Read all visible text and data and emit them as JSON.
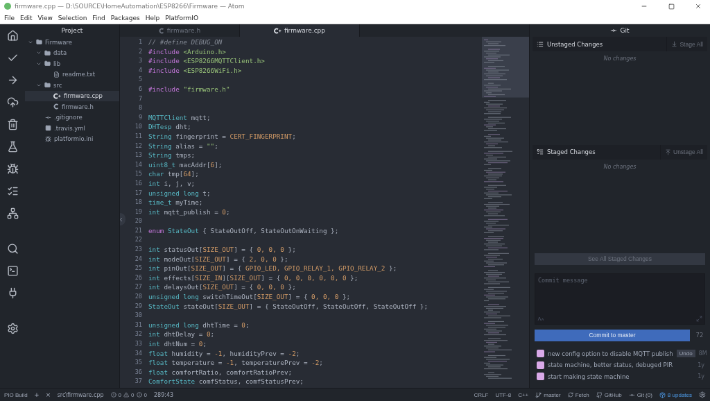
{
  "window": {
    "title": "firmware.cpp — D:\\SOURCE\\HomeAutomation\\ESP8266\\Firmware — Atom"
  },
  "menu": [
    "File",
    "Edit",
    "View",
    "Selection",
    "Find",
    "Packages",
    "Help",
    "PlatformIO"
  ],
  "project": {
    "title": "Project",
    "tree": [
      {
        "label": "Firmware",
        "kind": "folder",
        "expanded": true,
        "selected": false,
        "children": [
          {
            "label": "data",
            "kind": "folder",
            "expanded": true,
            "selected": false
          },
          {
            "label": "lib",
            "kind": "folder",
            "expanded": true,
            "selected": false,
            "children": [
              {
                "label": "readme.txt",
                "kind": "text",
                "selected": false
              }
            ]
          },
          {
            "label": "src",
            "kind": "folder",
            "expanded": true,
            "selected": false,
            "children": [
              {
                "label": "firmware.cpp",
                "kind": "cpp",
                "selected": true
              },
              {
                "label": "firmware.h",
                "kind": "c",
                "selected": false
              }
            ]
          },
          {
            "label": ".gitignore",
            "kind": "git",
            "selected": false
          },
          {
            "label": ".travis.yml",
            "kind": "yml",
            "selected": false
          },
          {
            "label": "platformio.ini",
            "kind": "pio",
            "selected": false
          }
        ]
      }
    ]
  },
  "tabs": [
    {
      "label": "firmware.h",
      "kind": "c",
      "selected": false
    },
    {
      "label": "firmware.cpp",
      "kind": "cpp",
      "selected": true
    }
  ],
  "code": [
    {
      "num": "1",
      "tokens": [
        {
          "kind": "comment",
          "text": "// #define DEBUG_ON"
        }
      ]
    },
    {
      "num": "2",
      "tokens": [
        {
          "kind": "directive",
          "text": "#include"
        },
        {
          "kind": "string",
          "text": " <Arduino.h>"
        }
      ]
    },
    {
      "num": "3",
      "tokens": [
        {
          "kind": "directive",
          "text": "#include"
        },
        {
          "kind": "string",
          "text": " <ESP8266MQTTClient.h>"
        }
      ]
    },
    {
      "num": "4",
      "tokens": [
        {
          "kind": "directive",
          "text": "#include"
        },
        {
          "kind": "string",
          "text": " <ESP8266WiFi.h>"
        }
      ]
    },
    {
      "num": "5"
    },
    {
      "num": "6",
      "tokens": [
        {
          "kind": "directive",
          "text": "#include"
        },
        {
          "kind": "string",
          "text": " \"firmware.h\""
        }
      ]
    },
    {
      "num": "7"
    },
    {
      "num": "8"
    },
    {
      "num": "9",
      "tokens": [
        {
          "kind": "type",
          "text": "MQTTClient"
        },
        {
          "kind": "plain",
          "text": " mqtt;"
        }
      ]
    },
    {
      "num": "10",
      "tokens": [
        {
          "kind": "type",
          "text": "DHTesp"
        },
        {
          "kind": "plain",
          "text": " dht;"
        }
      ]
    },
    {
      "num": "11",
      "tokens": [
        {
          "kind": "type",
          "text": "String"
        },
        {
          "kind": "plain",
          "text": " fingerprint = "
        },
        {
          "kind": "constant",
          "text": "CERT_FINGERPRINT"
        },
        {
          "kind": "plain",
          "text": ";"
        }
      ]
    },
    {
      "num": "12",
      "tokens": [
        {
          "kind": "type",
          "text": "String"
        },
        {
          "kind": "plain",
          "text": " alias = "
        },
        {
          "kind": "string",
          "text": "\"\""
        },
        {
          "kind": "plain",
          "text": ";"
        }
      ]
    },
    {
      "num": "13",
      "tokens": [
        {
          "kind": "type",
          "text": "String"
        },
        {
          "kind": "plain",
          "text": " tmps;"
        }
      ]
    },
    {
      "num": "14",
      "tokens": [
        {
          "kind": "type",
          "text": "uint8_t"
        },
        {
          "kind": "plain",
          "text": " macAddr["
        },
        {
          "kind": "constant",
          "text": "6"
        },
        {
          "kind": "plain",
          "text": "];"
        }
      ]
    },
    {
      "num": "15",
      "tokens": [
        {
          "kind": "type",
          "text": "char"
        },
        {
          "kind": "plain",
          "text": " tmp["
        },
        {
          "kind": "constant",
          "text": "64"
        },
        {
          "kind": "plain",
          "text": "];"
        }
      ]
    },
    {
      "num": "16",
      "tokens": [
        {
          "kind": "type",
          "text": "int"
        },
        {
          "kind": "plain",
          "text": " i, j, v;"
        }
      ]
    },
    {
      "num": "17",
      "tokens": [
        {
          "kind": "type",
          "text": "unsigned long"
        },
        {
          "kind": "plain",
          "text": " t;"
        }
      ]
    },
    {
      "num": "18",
      "tokens": [
        {
          "kind": "type",
          "text": "time_t"
        },
        {
          "kind": "plain",
          "text": " myTime;"
        }
      ]
    },
    {
      "num": "19",
      "tokens": [
        {
          "kind": "type",
          "text": "int"
        },
        {
          "kind": "plain",
          "text": " mqtt_publish = "
        },
        {
          "kind": "constant",
          "text": "0"
        },
        {
          "kind": "plain",
          "text": ";"
        }
      ]
    },
    {
      "num": "20"
    },
    {
      "num": "21",
      "tokens": [
        {
          "kind": "directive",
          "text": "enum"
        },
        {
          "kind": "type",
          "text": " StateOut"
        },
        {
          "kind": "plain",
          "text": " { StateOutOff, StateOutOnWaiting };"
        }
      ]
    },
    {
      "num": "22"
    },
    {
      "num": "23",
      "tokens": [
        {
          "kind": "type",
          "text": "int"
        },
        {
          "kind": "plain",
          "text": " statusOut["
        },
        {
          "kind": "constant",
          "text": "SIZE_OUT"
        },
        {
          "kind": "plain",
          "text": "] = { "
        },
        {
          "kind": "constant",
          "text": "0, 0, 0"
        },
        {
          "kind": "plain",
          "text": " };"
        }
      ]
    },
    {
      "num": "24",
      "tokens": [
        {
          "kind": "type",
          "text": "int"
        },
        {
          "kind": "plain",
          "text": " modeOut["
        },
        {
          "kind": "constant",
          "text": "SIZE_OUT"
        },
        {
          "kind": "plain",
          "text": "] = { "
        },
        {
          "kind": "constant",
          "text": "2, 0, 0"
        },
        {
          "kind": "plain",
          "text": " };"
        }
      ]
    },
    {
      "num": "25",
      "tokens": [
        {
          "kind": "type",
          "text": "int"
        },
        {
          "kind": "plain",
          "text": " pinOut["
        },
        {
          "kind": "constant",
          "text": "SIZE_OUT"
        },
        {
          "kind": "plain",
          "text": "] = { "
        },
        {
          "kind": "constant",
          "text": "GPIO_LED, GPIO_RELAY_1, GPIO_RELAY_2"
        },
        {
          "kind": "plain",
          "text": " };"
        }
      ]
    },
    {
      "num": "26",
      "tokens": [
        {
          "kind": "type",
          "text": "int"
        },
        {
          "kind": "plain",
          "text": " effects["
        },
        {
          "kind": "constant",
          "text": "SIZE_IN"
        },
        {
          "kind": "plain",
          "text": "]["
        },
        {
          "kind": "constant",
          "text": "SIZE_OUT"
        },
        {
          "kind": "plain",
          "text": "] = { "
        },
        {
          "kind": "constant",
          "text": "0, 0, 0, 0, 0, 0"
        },
        {
          "kind": "plain",
          "text": " };"
        }
      ]
    },
    {
      "num": "27",
      "tokens": [
        {
          "kind": "type",
          "text": "int"
        },
        {
          "kind": "plain",
          "text": " delaysOut["
        },
        {
          "kind": "constant",
          "text": "SIZE_OUT"
        },
        {
          "kind": "plain",
          "text": "] = { "
        },
        {
          "kind": "constant",
          "text": "0, 0, 0"
        },
        {
          "kind": "plain",
          "text": " };"
        }
      ]
    },
    {
      "num": "28",
      "tokens": [
        {
          "kind": "type",
          "text": "unsigned long"
        },
        {
          "kind": "plain",
          "text": " switchTimeOut["
        },
        {
          "kind": "constant",
          "text": "SIZE_OUT"
        },
        {
          "kind": "plain",
          "text": "] = { "
        },
        {
          "kind": "constant",
          "text": "0, 0, 0"
        },
        {
          "kind": "plain",
          "text": " };"
        }
      ]
    },
    {
      "num": "29",
      "tokens": [
        {
          "kind": "type",
          "text": "StateOut"
        },
        {
          "kind": "plain",
          "text": " stateOut["
        },
        {
          "kind": "constant",
          "text": "SIZE_OUT"
        },
        {
          "kind": "plain",
          "text": "] = { StateOutOff, StateOutOff, StateOutOff };"
        }
      ]
    },
    {
      "num": "30"
    },
    {
      "num": "31",
      "tokens": [
        {
          "kind": "type",
          "text": "unsigned long"
        },
        {
          "kind": "plain",
          "text": " dhtTime = "
        },
        {
          "kind": "constant",
          "text": "0"
        },
        {
          "kind": "plain",
          "text": ";"
        }
      ]
    },
    {
      "num": "32",
      "tokens": [
        {
          "kind": "type",
          "text": "int"
        },
        {
          "kind": "plain",
          "text": " dhtDelay = "
        },
        {
          "kind": "constant",
          "text": "0"
        },
        {
          "kind": "plain",
          "text": ";"
        }
      ]
    },
    {
      "num": "33",
      "tokens": [
        {
          "kind": "type",
          "text": "int"
        },
        {
          "kind": "plain",
          "text": " dhtNum = "
        },
        {
          "kind": "constant",
          "text": "0"
        },
        {
          "kind": "plain",
          "text": ";"
        }
      ]
    },
    {
      "num": "34",
      "tokens": [
        {
          "kind": "type",
          "text": "float"
        },
        {
          "kind": "plain",
          "text": " humidity = "
        },
        {
          "kind": "constant",
          "text": "-1"
        },
        {
          "kind": "plain",
          "text": ", humidityPrev = "
        },
        {
          "kind": "constant",
          "text": "-2"
        },
        {
          "kind": "plain",
          "text": ";"
        }
      ]
    },
    {
      "num": "35",
      "tokens": [
        {
          "kind": "type",
          "text": "float"
        },
        {
          "kind": "plain",
          "text": " temperature = "
        },
        {
          "kind": "constant",
          "text": "-1"
        },
        {
          "kind": "plain",
          "text": ", temperaturePrev = "
        },
        {
          "kind": "constant",
          "text": "-2"
        },
        {
          "kind": "plain",
          "text": ";"
        }
      ]
    },
    {
      "num": "36",
      "tokens": [
        {
          "kind": "type",
          "text": "float"
        },
        {
          "kind": "plain",
          "text": " comfortRatio, comfortRatioPrev;"
        }
      ]
    },
    {
      "num": "37",
      "tokens": [
        {
          "kind": "type",
          "text": "ComfortState"
        },
        {
          "kind": "plain",
          "text": " comfStatus, comfStatusPrev;"
        }
      ]
    }
  ],
  "git": {
    "title": "Git",
    "unstaged": {
      "title": "Unstaged Changes",
      "action": "Stage All",
      "empty": "No changes"
    },
    "staged": {
      "title": "Staged Changes",
      "action": "Unstage All",
      "empty": "No changes"
    },
    "see_all": "See All Staged Changes",
    "commit_message": {
      "placeholder": "Commit message"
    },
    "commit_button": "Commit to master",
    "remaining": "72",
    "commits": [
      {
        "message": "new config option to disable MQTT publish",
        "undo": "Undo",
        "time": "8M"
      },
      {
        "message": "state machine, better status, debuged PIR",
        "time": "1y"
      },
      {
        "message": "start making state machine",
        "time": "1y"
      }
    ]
  },
  "status_bar": {
    "left": {
      "build": "PIO Build",
      "add": "+",
      "close": "×",
      "file": "src\\firmware.cpp",
      "errors": "0",
      "warnings": "0",
      "infos": "0",
      "cursor": "289:43"
    },
    "right": {
      "line_ending": "CRLF",
      "encoding": "UTF-8",
      "grammar": "C++",
      "branch": "master",
      "fetch": "Fetch",
      "github": "GitHub",
      "git": "Git (0)",
      "updates": "8 updates"
    }
  }
}
